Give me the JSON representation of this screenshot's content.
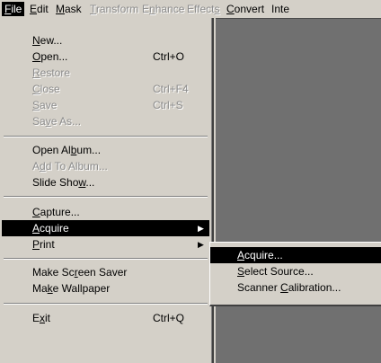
{
  "menubar": {
    "file": {
      "pre": "",
      "u": "F",
      "post": "ile"
    },
    "edit": {
      "pre": "",
      "u": "E",
      "post": "dit"
    },
    "mask": {
      "pre": "",
      "u": "M",
      "post": "ask"
    },
    "transform": {
      "pre": "",
      "u": "T",
      "post": "ransform"
    },
    "enhance": {
      "pre": "E",
      "u": "n",
      "post": "hance"
    },
    "effects": {
      "pre": "Effect",
      "u": "s",
      "post": ""
    },
    "convert": {
      "pre": "",
      "u": "C",
      "post": "onvert"
    },
    "inte": {
      "pre": "Inte",
      "u": "",
      "post": ""
    }
  },
  "file_menu": {
    "new": {
      "pre": "",
      "u": "N",
      "post": "ew..."
    },
    "open": {
      "pre": "",
      "u": "O",
      "post": "pen...",
      "shortcut": "Ctrl+O"
    },
    "restore": {
      "pre": "",
      "u": "R",
      "post": "estore"
    },
    "close": {
      "pre": "",
      "u": "C",
      "post": "lose",
      "shortcut": "Ctrl+F4"
    },
    "save": {
      "pre": "",
      "u": "S",
      "post": "ave",
      "shortcut": "Ctrl+S"
    },
    "save_as": {
      "pre": "Sa",
      "u": "v",
      "post": "e As..."
    },
    "open_album": {
      "pre": "Open Al",
      "u": "b",
      "post": "um..."
    },
    "add_to_album": {
      "pre": "A",
      "u": "d",
      "post": "d To Album..."
    },
    "slide_show": {
      "pre": "Slide Sho",
      "u": "w",
      "post": "..."
    },
    "capture": {
      "pre": "",
      "u": "C",
      "post": "apture..."
    },
    "acquire": {
      "pre": "",
      "u": "A",
      "post": "cquire"
    },
    "print": {
      "pre": "",
      "u": "P",
      "post": "rint"
    },
    "make_screen_saver": {
      "pre": "Make Sc",
      "u": "r",
      "post": "een Saver"
    },
    "make_wallpaper": {
      "pre": "Ma",
      "u": "k",
      "post": "e Wallpaper"
    },
    "exit": {
      "pre": "E",
      "u": "x",
      "post": "it",
      "shortcut": "Ctrl+Q"
    }
  },
  "acquire_submenu": {
    "acquire": {
      "pre": "",
      "u": "A",
      "post": "cquire..."
    },
    "select_source": {
      "pre": "",
      "u": "S",
      "post": "elect Source..."
    },
    "scanner_calibration": {
      "pre": "Scanner ",
      "u": "C",
      "post": "alibration..."
    }
  },
  "icons": {
    "submenu_arrow": "▶"
  }
}
